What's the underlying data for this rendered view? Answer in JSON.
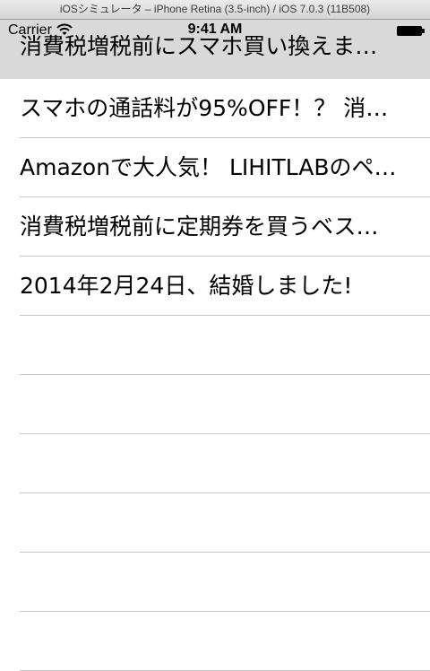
{
  "window": {
    "title": "iOSシミュレータ – iPhone Retina (3.5-inch) / iOS 7.0.3 (11B508)"
  },
  "status_bar": {
    "carrier": "Carrier",
    "time": "9:41 AM",
    "wifi_icon": "wifi-icon",
    "battery_icon": "battery-icon"
  },
  "list": {
    "selected_index": 0,
    "rows": [
      {
        "title": "消費税増税前にスマホ買い換えま…"
      },
      {
        "title": "スマホの通話料が95%OFF！？ 消…"
      },
      {
        "title": "Amazonで大人気！ LIHITLABのペ…"
      },
      {
        "title": "消費税増税前に定期券を買うベス…"
      },
      {
        "title": "2014年2月24日、結婚しました!"
      },
      {
        "title": ""
      },
      {
        "title": ""
      },
      {
        "title": ""
      },
      {
        "title": ""
      },
      {
        "title": ""
      },
      {
        "title": ""
      }
    ]
  },
  "colors": {
    "selected_row": "#d9d9d9",
    "separator": "#c8c7cc"
  }
}
